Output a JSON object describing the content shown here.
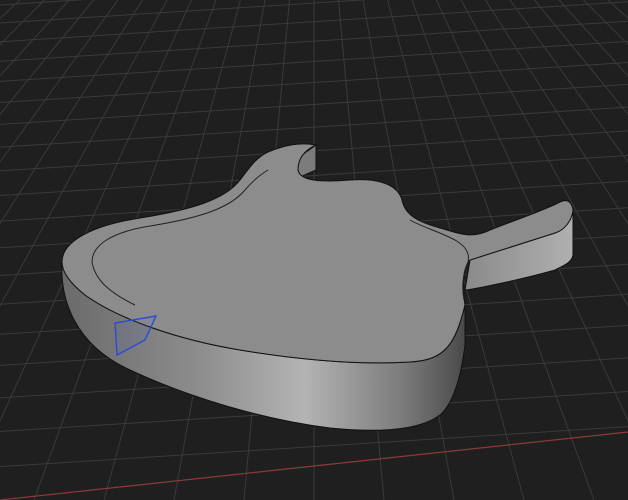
{
  "viewport": {
    "background_color": "#1f1f1f",
    "grid_line_color": "#3a3a3a",
    "grid_axis_x_color": "#8a3a3a"
  },
  "model": {
    "top_face_color": "#8c8c8c",
    "side_face_color_light": "#a0a0a0",
    "side_face_color_dark": "#5a5a5a",
    "edge_color": "#111111"
  },
  "selection": {
    "highlight_color": "#2a4bd7",
    "selected_element": "face"
  }
}
